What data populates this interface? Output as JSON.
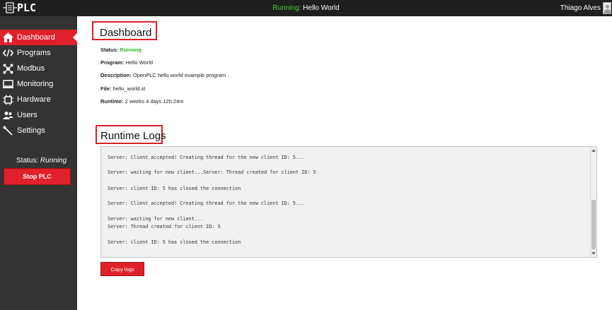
{
  "app": {
    "logo_text": "PLC"
  },
  "topbar": {
    "status_label": "Running:",
    "program_name": "Hello World",
    "user_name": "Thiago Alves"
  },
  "sidebar": {
    "items": [
      {
        "label": "Dashboard",
        "icon": "home-icon"
      },
      {
        "label": "Programs",
        "icon": "code-icon"
      },
      {
        "label": "Modbus",
        "icon": "network-icon"
      },
      {
        "label": "Monitoring",
        "icon": "monitor-icon"
      },
      {
        "label": "Hardware",
        "icon": "chip-icon"
      },
      {
        "label": "Users",
        "icon": "users-icon"
      },
      {
        "label": "Settings",
        "icon": "wrench-icon"
      }
    ],
    "status_label": "Status:",
    "status_value": "Running",
    "stop_button": "Stop PLC"
  },
  "dashboard": {
    "title": "Dashboard",
    "status_label": "Status:",
    "status_value": "Running",
    "program_label": "Program:",
    "program_value": "Hello World",
    "description_label": "Description:",
    "description_value": "OpenPLC hello world example program",
    "file_label": "File:",
    "file_value": "hello_world.st",
    "runtime_label": "Runtime:",
    "runtime_value": "2 weeks 4 days 12h:24m"
  },
  "logs": {
    "title": "Runtime Logs",
    "lines": [
      "Server: Client accepted! Creating thread for the new client ID: 5...",
      "Server: waiting for new client...Server: Thread created for client ID: 5",
      "Server: client ID: 5 has closed the connection",
      "Server: Client accepted! Creating thread for the new client ID: 5...",
      "Server: waiting for new client...",
      "Server: Thread created for client ID: 5",
      "Server: client ID: 5 has closed the connection"
    ],
    "copy_button": "Copy logs"
  },
  "colors": {
    "accent": "#e0202b",
    "sidebar_bg": "#333333",
    "topbar_bg": "#1f1f1f",
    "running": "#2db52d"
  }
}
